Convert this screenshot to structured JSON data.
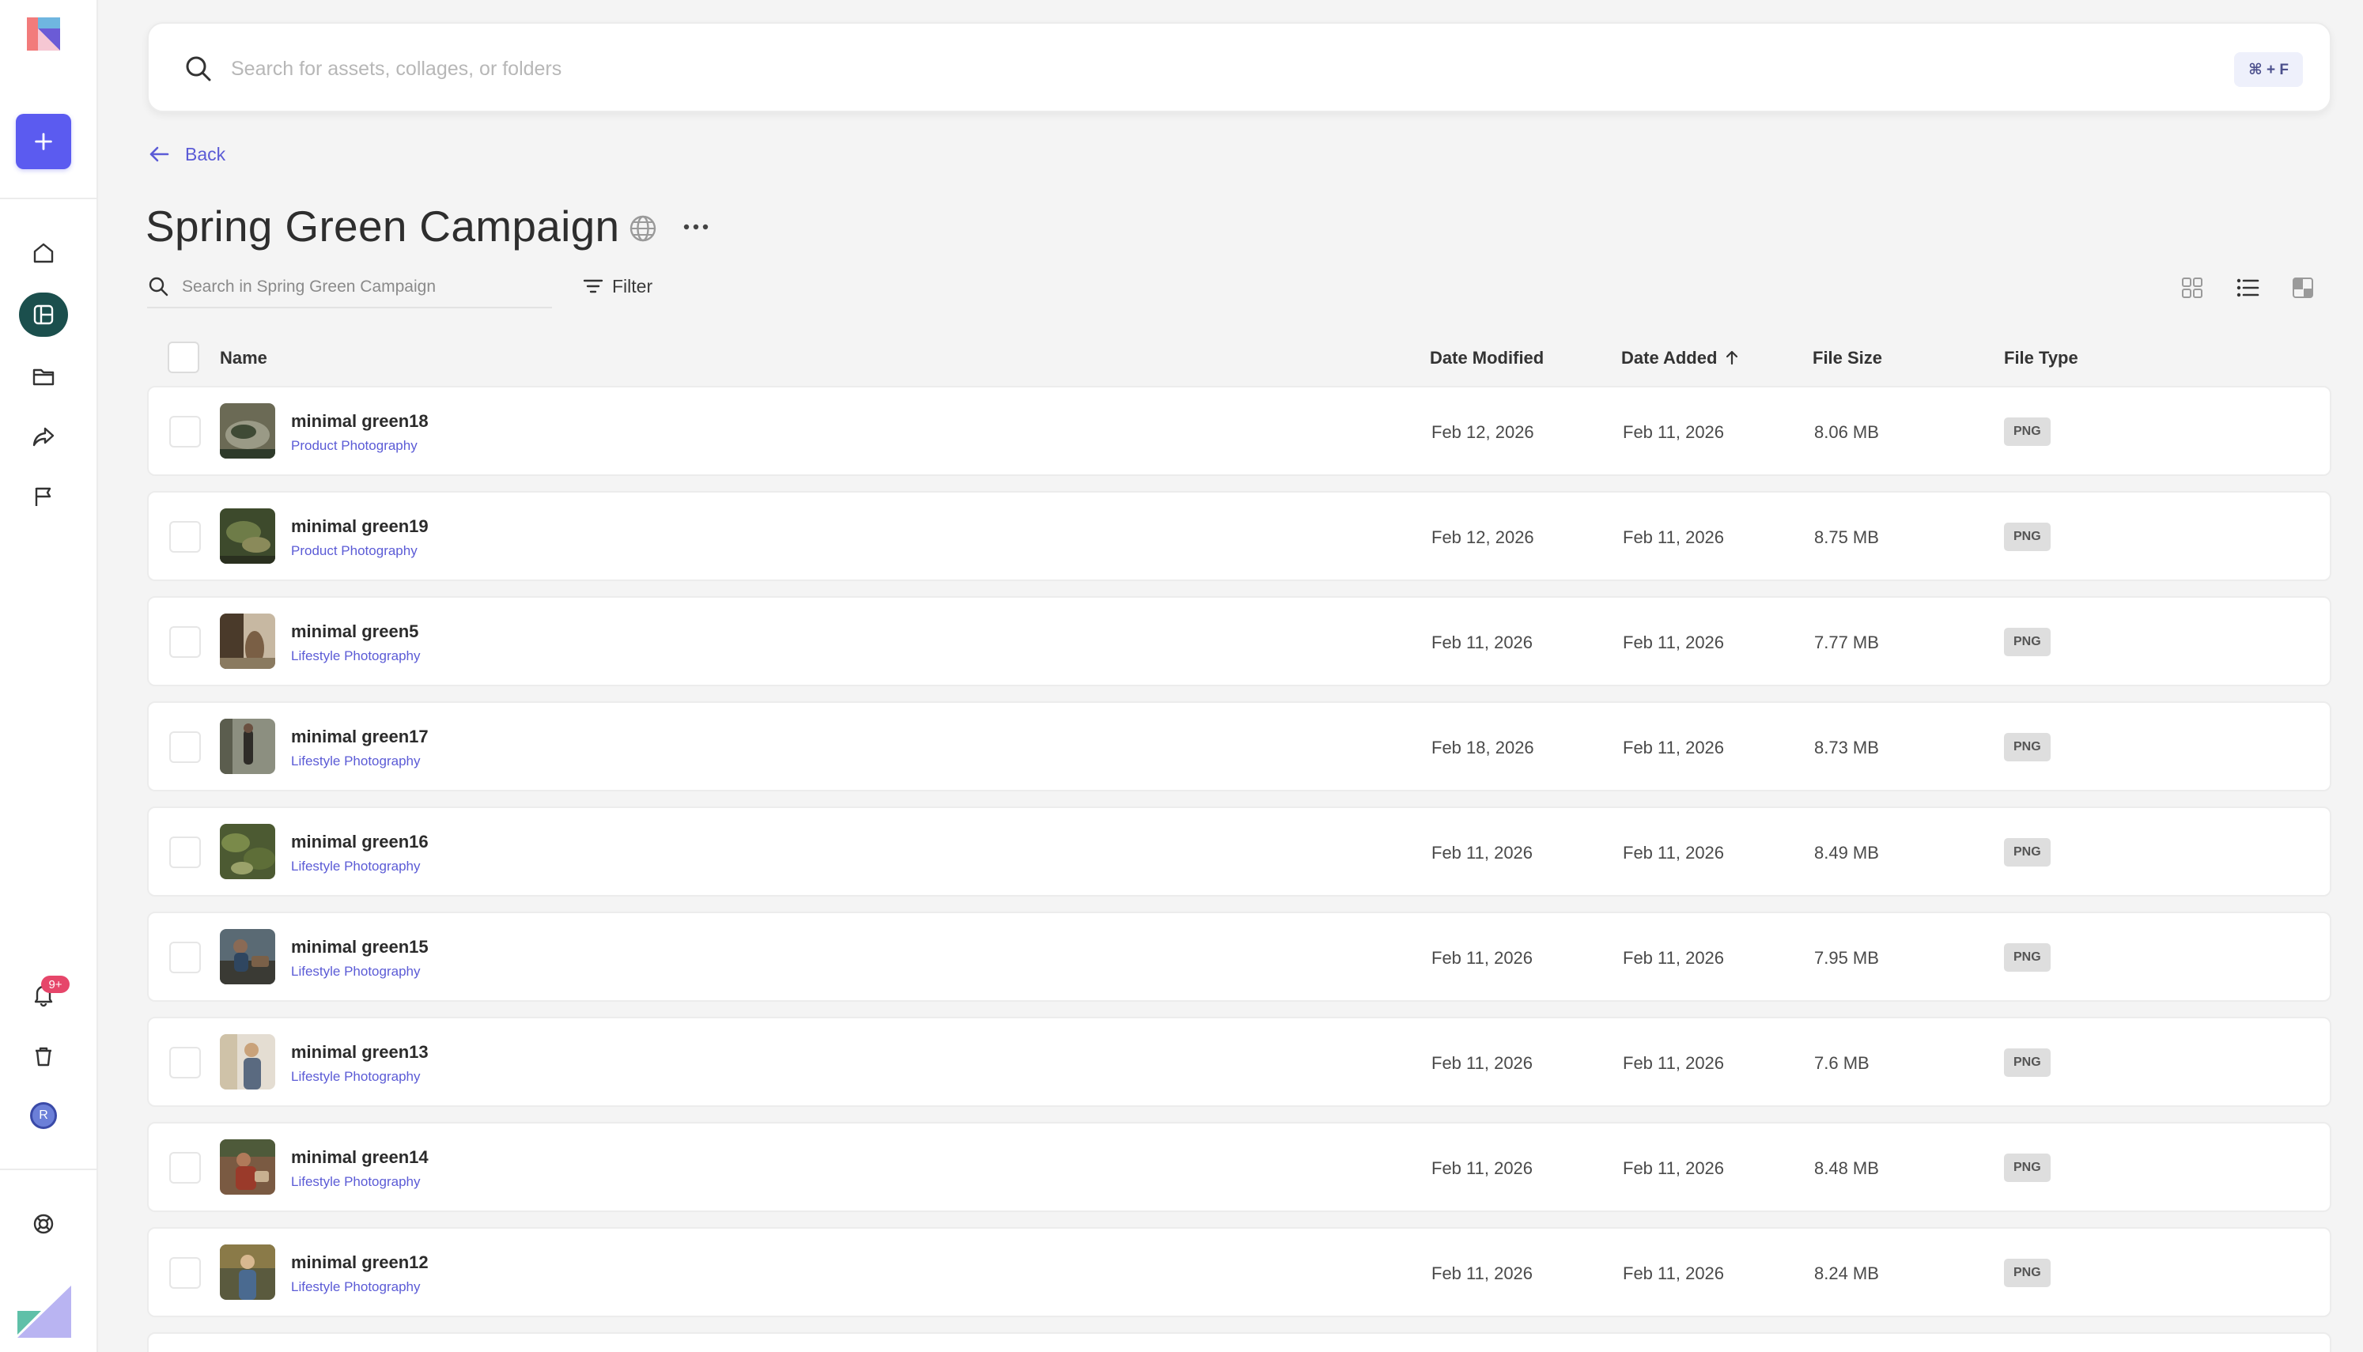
{
  "colors": {
    "accent": "#5b5bf0",
    "sidebar_active": "#1b4f4d",
    "badge": "#e6466a",
    "link": "#5b5bd6"
  },
  "sidebar": {
    "items": [
      {
        "icon": "home-icon"
      },
      {
        "icon": "collections-icon",
        "active": true
      },
      {
        "icon": "folder-icon"
      },
      {
        "icon": "share-icon"
      },
      {
        "icon": "flag-icon"
      }
    ],
    "notifications_badge": "9+",
    "avatar_initial": "R"
  },
  "search": {
    "placeholder": "Search for assets, collages, or folders",
    "shortcut": "⌘ + F"
  },
  "nav": {
    "back_label": "Back"
  },
  "page": {
    "title": "Spring Green Campaign"
  },
  "toolbar": {
    "search_placeholder": "Search in Spring Green Campaign",
    "filter_label": "Filter"
  },
  "table": {
    "columns": {
      "name": "Name",
      "date_modified": "Date Modified",
      "date_added": "Date Added",
      "file_size": "File Size",
      "file_type": "File Type"
    },
    "rows": [
      {
        "name": "minimal green18",
        "tag": "Product Photography",
        "modified": "Feb 12, 2026",
        "added": "Feb 11, 2026",
        "size": "8.06 MB",
        "type": "PNG"
      },
      {
        "name": "minimal green19",
        "tag": "Product Photography",
        "modified": "Feb 12, 2026",
        "added": "Feb 11, 2026",
        "size": "8.75 MB",
        "type": "PNG"
      },
      {
        "name": "minimal green5",
        "tag": "Lifestyle Photography",
        "modified": "Feb 11, 2026",
        "added": "Feb 11, 2026",
        "size": "7.77 MB",
        "type": "PNG"
      },
      {
        "name": "minimal green17",
        "tag": "Lifestyle Photography",
        "modified": "Feb 18, 2026",
        "added": "Feb 11, 2026",
        "size": "8.73 MB",
        "type": "PNG"
      },
      {
        "name": "minimal green16",
        "tag": "Lifestyle Photography",
        "modified": "Feb 11, 2026",
        "added": "Feb 11, 2026",
        "size": "8.49 MB",
        "type": "PNG"
      },
      {
        "name": "minimal green15",
        "tag": "Lifestyle Photography",
        "modified": "Feb 11, 2026",
        "added": "Feb 11, 2026",
        "size": "7.95 MB",
        "type": "PNG"
      },
      {
        "name": "minimal green13",
        "tag": "Lifestyle Photography",
        "modified": "Feb 11, 2026",
        "added": "Feb 11, 2026",
        "size": "7.6 MB",
        "type": "PNG"
      },
      {
        "name": "minimal green14",
        "tag": "Lifestyle Photography",
        "modified": "Feb 11, 2026",
        "added": "Feb 11, 2026",
        "size": "8.48 MB",
        "type": "PNG"
      },
      {
        "name": "minimal green12",
        "tag": "Lifestyle Photography",
        "modified": "Feb 11, 2026",
        "added": "Feb 11, 2026",
        "size": "8.24 MB",
        "type": "PNG"
      }
    ]
  }
}
